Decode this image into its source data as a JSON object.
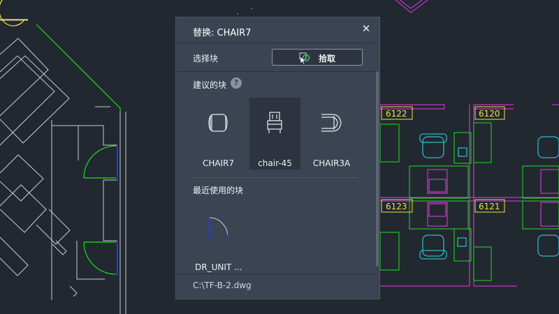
{
  "drawing": {
    "room_labels": [
      "6122",
      "6120",
      "6123",
      "6121"
    ],
    "colors": {
      "background": "#212830",
      "wall": "#c9cdd2",
      "green": "#22dd22",
      "magenta": "#e63be6",
      "cyan": "#2ee1ee",
      "yellow": "#f1e23c",
      "blue": "#2838e0"
    }
  },
  "dialog": {
    "title": "替换: CHAIR7",
    "close_icon": "close-icon",
    "select_block_label": "选择块",
    "pick_button_label": "拾取",
    "pick_icon": "pick-cursor-icon",
    "suggested_title": "建议的块",
    "help_icon": "question-icon",
    "help_glyph": "?",
    "suggested_blocks": [
      {
        "label": "CHAIR7",
        "icon": "chair7-block-icon",
        "selected": false
      },
      {
        "label": "chair-45",
        "icon": "chair45-block-icon",
        "selected": true
      },
      {
        "label": "CHAIR3A",
        "icon": "chair3a-block-icon",
        "selected": false
      }
    ],
    "recent_title": "最近使用的块",
    "recent_blocks": [
      {
        "label": "DR_UNIT ...",
        "icon": "door-unit-block-icon"
      }
    ],
    "footer_path": "C:\\TF-B-2.dwg"
  }
}
